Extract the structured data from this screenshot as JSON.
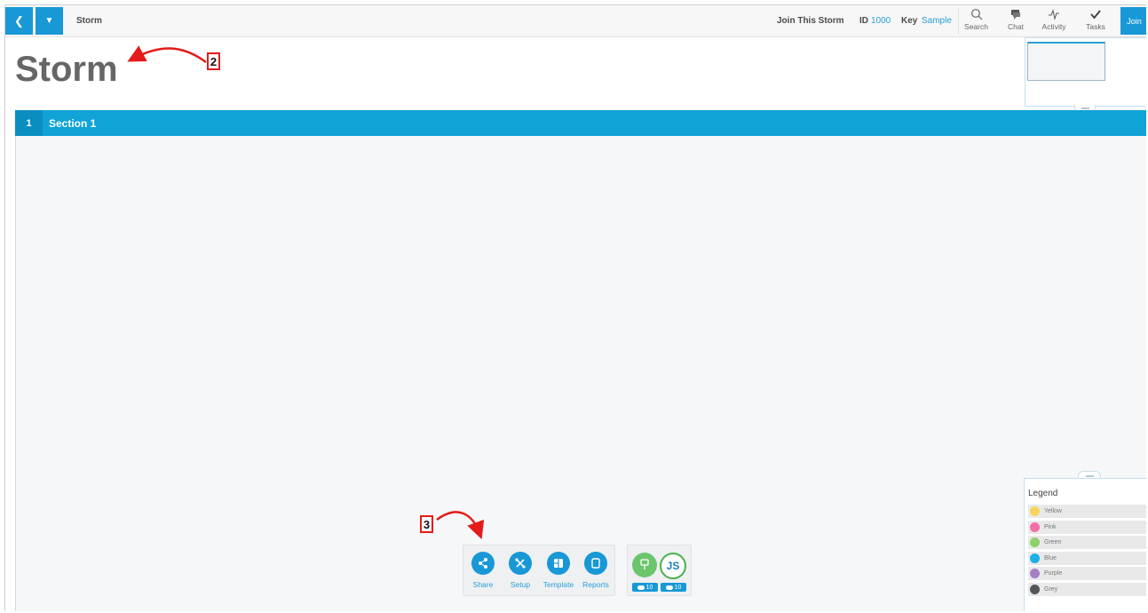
{
  "header": {
    "back_icon": "chevron-left-icon",
    "menu_icon": "chevron-down-icon",
    "app_title": "Storm",
    "join_text": "Join This Storm",
    "id_label": "ID",
    "id_value": "1000",
    "key_label": "Key",
    "key_value": "Sample",
    "tools": [
      {
        "label": "Search",
        "icon": "search-icon"
      },
      {
        "label": "Chat",
        "icon": "chat-icon"
      },
      {
        "label": "Activity",
        "icon": "activity-icon"
      },
      {
        "label": "Tasks",
        "icon": "check-icon"
      }
    ],
    "join_button": "Join"
  },
  "page": {
    "title": "Storm"
  },
  "section": {
    "number": "1",
    "name": "Section 1"
  },
  "legend": {
    "title": "Legend",
    "items": [
      {
        "label": "Yellow",
        "color": "#f7d55c"
      },
      {
        "label": "Pink",
        "color": "#f26fa8"
      },
      {
        "label": "Green",
        "color": "#8fd16a"
      },
      {
        "label": "Blue",
        "color": "#1ab0e8"
      },
      {
        "label": "Purple",
        "color": "#a57fc6"
      },
      {
        "label": "Grey",
        "color": "#55565a"
      }
    ]
  },
  "toolbar": {
    "buttons": [
      {
        "label": "Share",
        "icon": "share-icon"
      },
      {
        "label": "Setup",
        "icon": "setup-icon"
      },
      {
        "label": "Template",
        "icon": "template-icon"
      },
      {
        "label": "Reports",
        "icon": "reports-icon"
      }
    ]
  },
  "users": {
    "avatar_initials": "JS",
    "badge_1": "10",
    "badge_2": "10"
  },
  "annotations": {
    "label_2": "2",
    "label_3": "3"
  },
  "colors": {
    "accent": "#1898d6",
    "section_bar": "#0fa3d6",
    "annotation": "#e41b1b"
  }
}
